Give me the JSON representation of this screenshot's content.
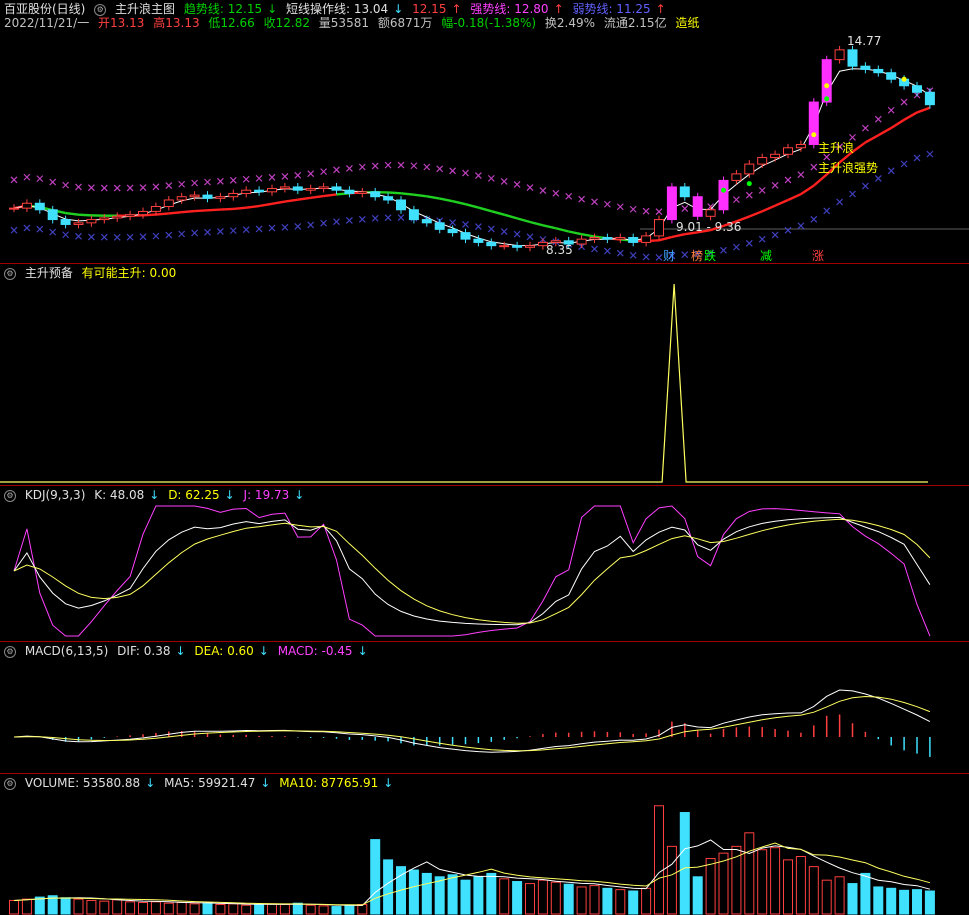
{
  "header": {
    "stock_name": "百亚股份(日线)",
    "indicator_name": "主升浪主图",
    "trend_label": "趋势线: 12.15",
    "short_label": "短线操作线: 13.04",
    "level_value": "12.15",
    "strong_label": "强势线: 12.80",
    "weak_label": "弱势线: 11.25",
    "date": "2022/11/21/一",
    "open": "开13.13",
    "high": "高13.13",
    "low": "低12.66",
    "close": "收12.82",
    "volume": "量53581",
    "amount": "额6871万",
    "change": "幅-0.18(-1.38%)",
    "turnover": "换2.49%",
    "float_cap": "流通2.15亿",
    "sector": "造纸"
  },
  "main_panel": {
    "high_label": "14.77",
    "low_label": "8.35",
    "range_label": "9.01 - 9.36",
    "signal_wave": "主升浪",
    "signal_strong": "主升浪强势",
    "markers": [
      {
        "text": "财",
        "color": "#40a0ff"
      },
      {
        "text": "榜",
        "color": "#ff8040"
      },
      {
        "text": "跌",
        "color": "#00ff00"
      },
      {
        "text": "减",
        "color": "#00ff00"
      },
      {
        "text": "涨",
        "color": "#ff4040"
      }
    ]
  },
  "pre_panel": {
    "title": "主升预备",
    "label": "有可能主升: 0.00"
  },
  "kdj_panel": {
    "title": "KDJ(9,3,3)",
    "k": "K: 48.08",
    "d": "D: 62.25",
    "j": "J: 19.73"
  },
  "macd_panel": {
    "title": "MACD(6,13,5)",
    "dif": "DIF: 0.38",
    "dea": "DEA: 0.60",
    "macd": "MACD: -0.45"
  },
  "vol_panel": {
    "title": "VOLUME: 53580.88",
    "ma5": "MA5: 59921.47",
    "ma10": "MA10: 87765.91"
  },
  "colors": {
    "up": "#ff4040",
    "down": "#40e0ff",
    "bg": "#000000",
    "separator": "#a00000"
  },
  "chart_data": {
    "type": "candlestick",
    "close": [
      9.65,
      9.8,
      9.6,
      9.3,
      9.15,
      9.2,
      9.3,
      9.35,
      9.4,
      9.45,
      9.55,
      9.7,
      9.9,
      10.0,
      10.05,
      9.95,
      10.0,
      10.1,
      10.2,
      10.15,
      10.25,
      10.3,
      10.2,
      10.25,
      10.3,
      10.2,
      10.1,
      10.15,
      10.0,
      9.9,
      9.6,
      9.3,
      9.2,
      9.0,
      8.9,
      8.7,
      8.6,
      8.5,
      8.5,
      8.45,
      8.5,
      8.6,
      8.65,
      8.55,
      8.7,
      8.75,
      8.7,
      8.75,
      8.6,
      8.8,
      9.3,
      10.3,
      10.0,
      9.4,
      9.6,
      10.5,
      10.7,
      11.0,
      11.2,
      11.3,
      11.5,
      11.6,
      12.9,
      14.2,
      14.5,
      14.0,
      13.9,
      13.8,
      13.6,
      13.4,
      13.2,
      12.82
    ],
    "volume": [
      20000,
      22000,
      25000,
      27000,
      24000,
      22000,
      20000,
      19000,
      21000,
      18000,
      17000,
      18000,
      16000,
      17000,
      15000,
      16000,
      14000,
      15000,
      13000,
      14000,
      15000,
      14000,
      16000,
      13000,
      12000,
      11000,
      13000,
      14000,
      110000,
      80000,
      70000,
      65000,
      60000,
      55000,
      58000,
      50000,
      55000,
      60000,
      52000,
      48000,
      45000,
      50000,
      47000,
      44000,
      40000,
      42000,
      38000,
      36000,
      34000,
      38000,
      160000,
      100000,
      150000,
      55000,
      82000,
      90000,
      100000,
      120000,
      95000,
      98000,
      80000,
      85000,
      70000,
      50000,
      55000,
      45000,
      60000,
      40000,
      38000,
      35000,
      36000,
      34000
    ],
    "kdj": {
      "k": "48.08",
      "d": "62.25",
      "j": "19.73"
    },
    "macd": {
      "dif": "0.38",
      "dea": "0.60",
      "macd": "-0.45"
    },
    "pre_signal_peak_index": 49
  }
}
